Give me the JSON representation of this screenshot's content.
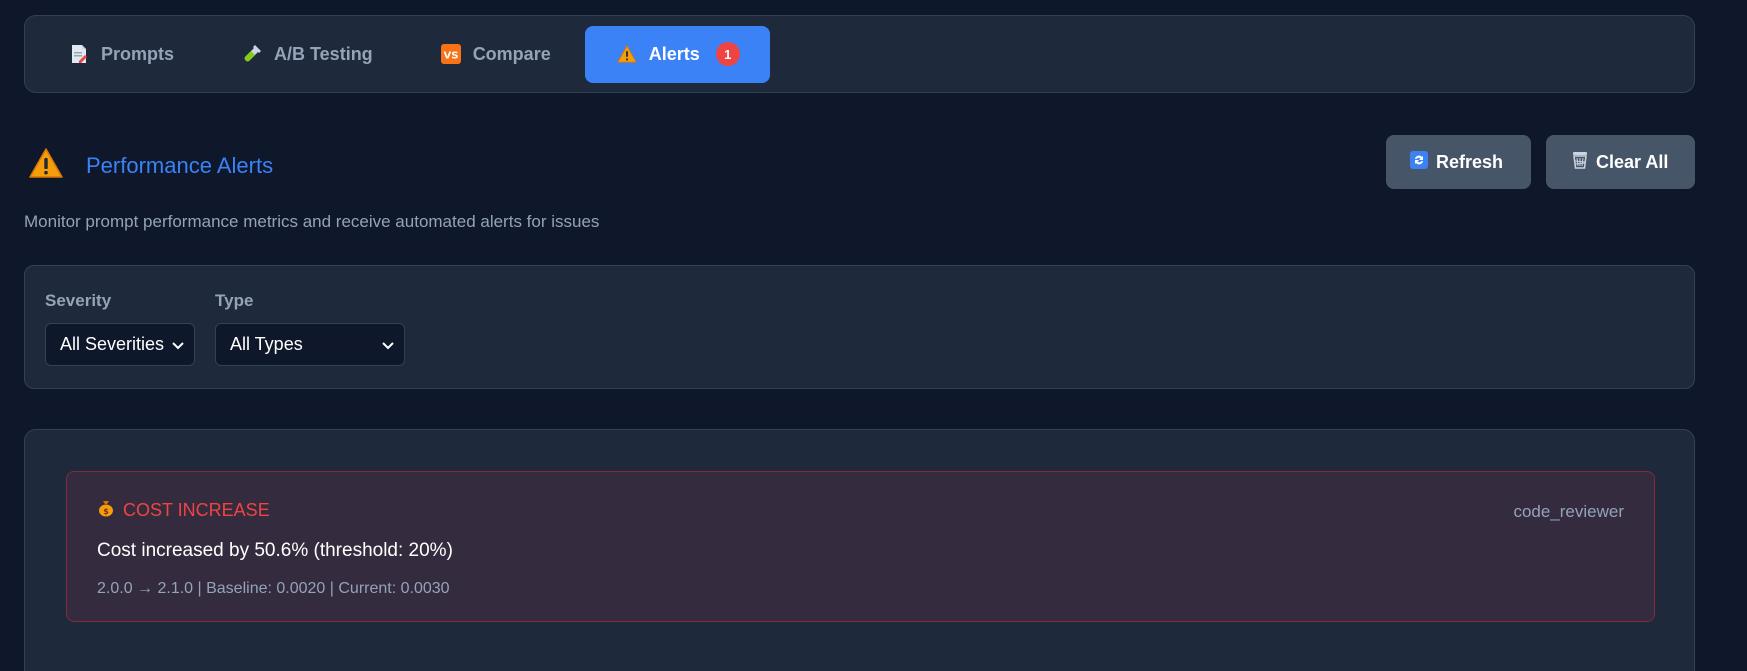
{
  "tabs": [
    {
      "label": "Prompts",
      "icon": "document-icon",
      "active": false
    },
    {
      "label": "A/B Testing",
      "icon": "test-tube-icon",
      "active": false
    },
    {
      "label": "Compare",
      "icon": "vs-icon",
      "active": false
    },
    {
      "label": "Alerts",
      "icon": "warning-icon",
      "active": true,
      "badge": "1"
    }
  ],
  "header": {
    "title": "Performance Alerts",
    "icon": "warning-icon",
    "refresh_label": "Refresh",
    "clear_label": "Clear All"
  },
  "subtitle": "Monitor prompt performance metrics and receive automated alerts for issues",
  "filters": {
    "severity": {
      "label": "Severity",
      "value": "All Severities"
    },
    "type": {
      "label": "Type",
      "value": "All Types"
    }
  },
  "alerts": [
    {
      "type": "COST INCREASE",
      "icon": "money-bag-icon",
      "prompt": "code_reviewer",
      "message": "Cost increased by 50.6% (threshold: 20%)",
      "meta": "2.0.0 → 2.1.0 | Baseline: 0.0020 | Current: 0.0030"
    }
  ],
  "colors": {
    "background": "#0f172a",
    "surface": "#1e293b",
    "accent": "#3b82f6",
    "danger": "#ef4444",
    "button": "#475569"
  }
}
